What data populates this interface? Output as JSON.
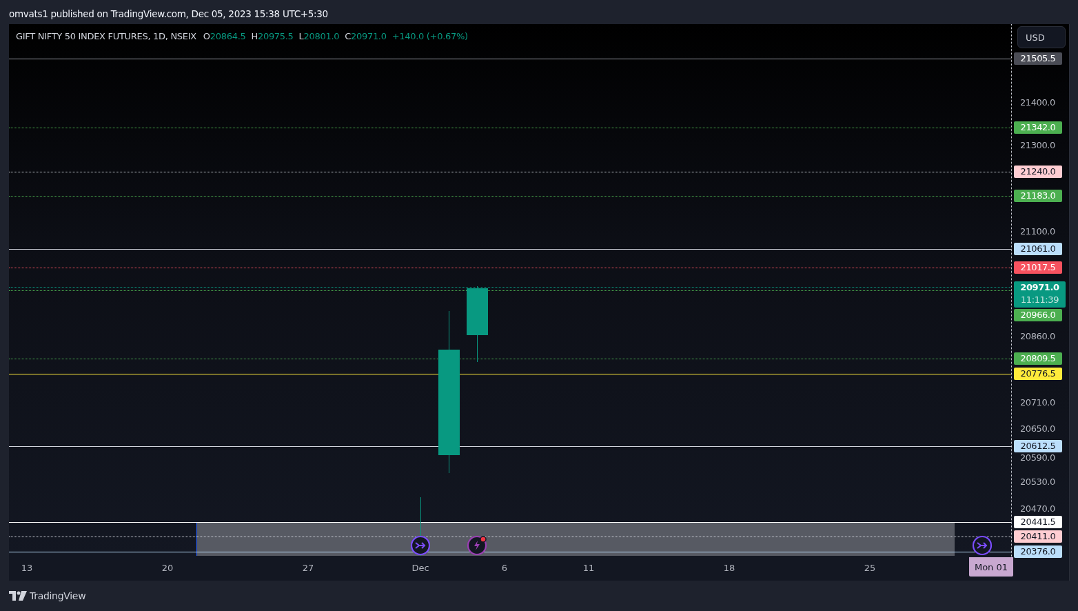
{
  "publish_note": "omvats1 published on TradingView.com, Dec 05, 2023 15:38 UTC+5:30",
  "legend": {
    "symbol": "GIFT NIFTY 50 INDEX FUTURES, 1D, NSEIX",
    "ohlc": [
      {
        "label": "O",
        "value": "20864.5"
      },
      {
        "label": "H",
        "value": "20975.5"
      },
      {
        "label": "L",
        "value": "20801.0"
      },
      {
        "label": "C",
        "value": "20971.0"
      }
    ],
    "change": "+140.0 (+0.67%)"
  },
  "currency_button": "USD",
  "levels": [
    {
      "kind": "line",
      "label": "21505.5",
      "color": "#4a4c55",
      "line": {
        "color": "#9598a1",
        "dotted": false
      }
    },
    {
      "kind": "line",
      "label": "21342.0",
      "color": "#4caf50",
      "line": {
        "color": "#4caf50",
        "dotted": true
      }
    },
    {
      "kind": "line",
      "label": "21240.0",
      "color": "#ffcdd2",
      "line": {
        "color": "#d1d4dc",
        "dotted": true
      }
    },
    {
      "kind": "line",
      "label": "21183.0",
      "color": "#4caf50",
      "line": {
        "color": "#4caf50",
        "dotted": true
      }
    },
    {
      "kind": "line",
      "label": "21061.0",
      "color": "#bbdefb",
      "line": {
        "color": "#d1d4dc",
        "dotted": false
      }
    },
    {
      "kind": "line",
      "label": "21017.5",
      "color": "#f7525f",
      "line": {
        "color": "#f7525f",
        "dotted": true
      }
    },
    {
      "kind": "current",
      "label": "20971.0",
      "countdown": "11:11:39",
      "color": "#089981",
      "line": {
        "color": "#089981",
        "dotted": true
      }
    },
    {
      "kind": "line",
      "label": "20966.0",
      "color": "#4caf50",
      "line": {
        "color": "#4caf50",
        "dotted": true
      }
    },
    {
      "kind": "line",
      "label": "20809.5",
      "color": "#4caf50",
      "line": {
        "color": "#4caf50",
        "dotted": true
      }
    },
    {
      "kind": "line",
      "label": "20776.5",
      "color": "#ffeb3b",
      "line": {
        "color": "#ffeb3b",
        "dotted": false
      }
    },
    {
      "kind": "line",
      "label": "20612.5",
      "color": "#bbdefb",
      "line": {
        "color": "#d1d4dc",
        "dotted": false
      }
    },
    {
      "kind": "line",
      "label": "20441.5",
      "color": "#ffffff",
      "line": {
        "color": "#ffffff",
        "dotted": false
      }
    },
    {
      "kind": "line",
      "label": "20411.0",
      "color": "#ffcdd2",
      "line": {
        "color": "#d1d4dc",
        "dotted": true
      }
    },
    {
      "kind": "line",
      "label": "20376.0",
      "color": "#bbdefb",
      "line": {
        "color": "#bbdefb",
        "dotted": false
      }
    }
  ],
  "price_ticks": [
    "21400.0",
    "21300.0",
    "21100.0",
    "20860.0",
    "20710.0",
    "20650.0",
    "20590.0",
    "20530.0",
    "20470.0"
  ],
  "time_ticks": [
    "13",
    "20",
    "27",
    "Dec",
    "6",
    "11",
    "18",
    "25"
  ],
  "time_marker": "Mon 01",
  "footer_logo": "TradingView"
}
